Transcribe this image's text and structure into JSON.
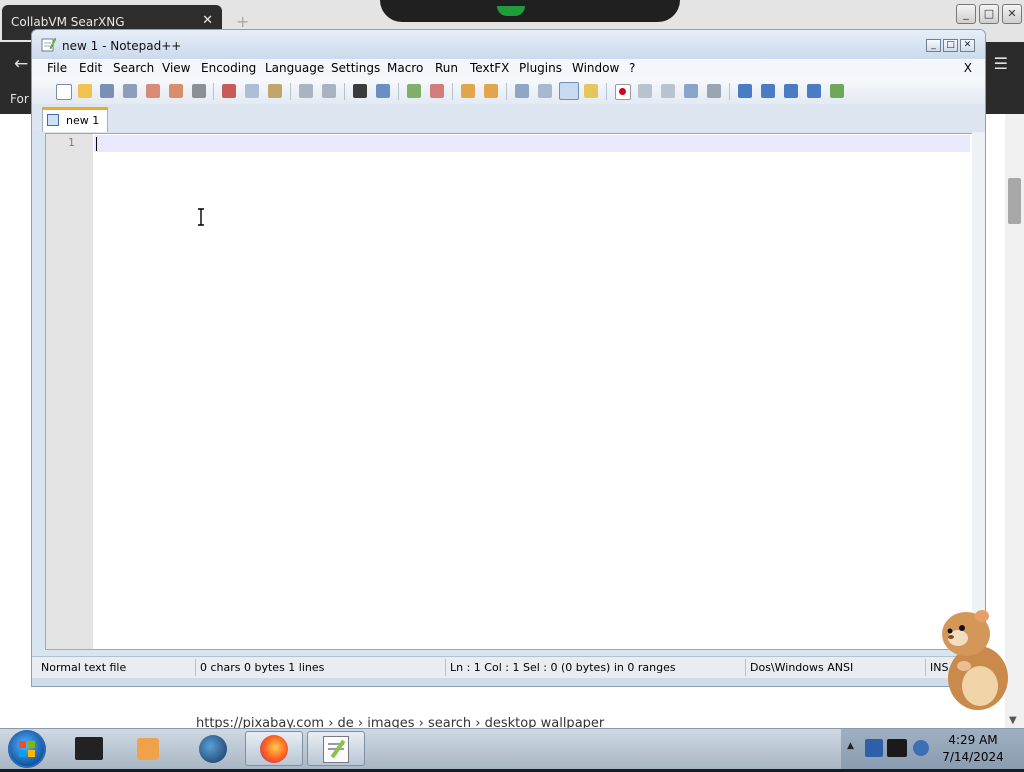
{
  "browser": {
    "tab_title": "CollabVM SearXNG",
    "tab_close": "✕",
    "new_tab": "+",
    "back": "←",
    "menu": "☰",
    "left_text": "For",
    "url_hint": "https://pixabay.com › de › images › search › desktop wallpaper",
    "scroll_down": "▼"
  },
  "notepad": {
    "title": "new 1 - Notepad++",
    "controls": {
      "minimize": "_",
      "maximize": "□",
      "close": "✕"
    },
    "menu": [
      "File",
      "Edit",
      "Search",
      "View",
      "Encoding",
      "Language",
      "Settings",
      "Macro",
      "Run",
      "TextFX",
      "Plugins",
      "Window",
      "?"
    ],
    "menu_close": "X",
    "tab_label": "new  1",
    "line_number": "1",
    "status": {
      "file_type": "Normal text file",
      "counts": "0 chars   0 bytes   1 lines",
      "position": "Ln : 1    Col : 1    Sel : 0 (0 bytes) in 0 ranges",
      "eol_encoding": "Dos\\Windows  ANSI",
      "mode": "INS"
    }
  },
  "taskbar": {
    "time": "4:29 AM",
    "date": "7/14/2024"
  },
  "colors": {
    "accent_tab": "#f5a623",
    "current_line": "#e8e8ff"
  }
}
